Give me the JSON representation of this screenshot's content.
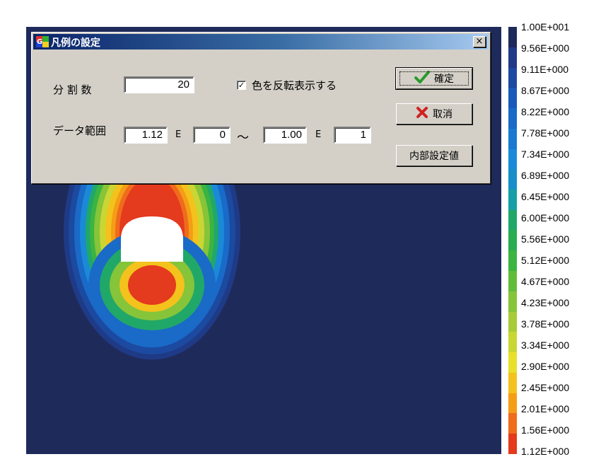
{
  "dialog": {
    "title": "凡例の設定",
    "close_glyph": "×",
    "divisions_label": "分 割 数",
    "divisions_value": "20",
    "invert_checkbox_label": "色を反転表示する",
    "invert_checked": true,
    "check_glyph": "✓",
    "data_range_label": "データ範囲",
    "min_mantissa": "1.12",
    "min_exponent_label": "E",
    "min_exponent": "0",
    "range_separator": "～",
    "max_mantissa": "1.00",
    "max_exponent_label": "E",
    "max_exponent": "1",
    "ok_label": "確定",
    "cancel_label": "取消",
    "internal_label": "内部設定値",
    "ok_icon": "check-icon",
    "cancel_icon": "x-icon"
  },
  "legend": {
    "labels": [
      "1.00E+001",
      "9.56E+000",
      "9.11E+000",
      "8.67E+000",
      "8.22E+000",
      "7.78E+000",
      "7.34E+000",
      "6.89E+000",
      "6.45E+000",
      "6.00E+000",
      "5.56E+000",
      "5.12E+000",
      "4.67E+000",
      "4.23E+000",
      "3.78E+000",
      "3.34E+000",
      "2.90E+000",
      "2.45E+000",
      "2.01E+000",
      "1.56E+000",
      "1.12E+000"
    ],
    "colors": [
      "#1e2a5a",
      "#1f3a86",
      "#1b4aa0",
      "#1a5ab8",
      "#1a6ac8",
      "#1a7ad2",
      "#1a8ad8",
      "#178fc8",
      "#15a0a5",
      "#20a868",
      "#2aac50",
      "#3bb441",
      "#62bc3b",
      "#86c43a",
      "#a7cc38",
      "#c9d633",
      "#e8e02a",
      "#f4c21c",
      "#f59d16",
      "#ee6c1c",
      "#e43a1e"
    ],
    "plot_bg": "#1e2a5a"
  }
}
